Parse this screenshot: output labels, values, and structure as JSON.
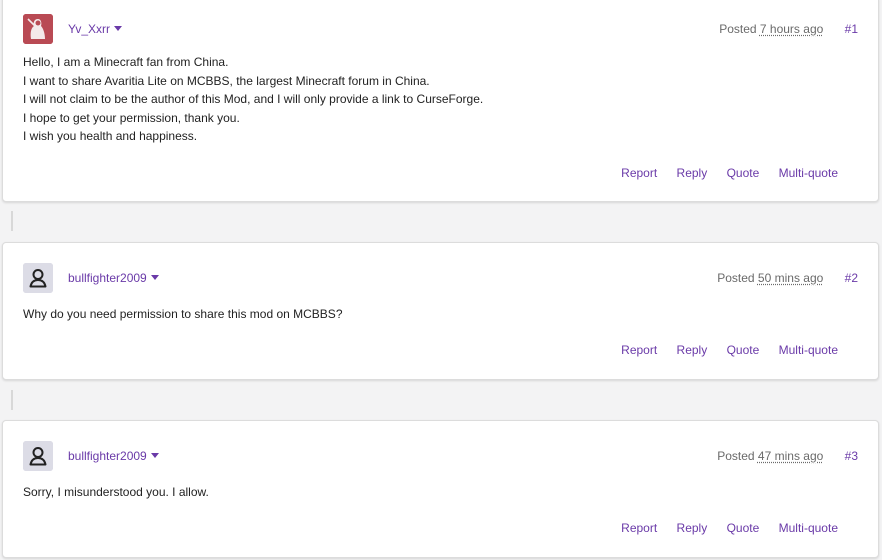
{
  "posts": [
    {
      "author": "Yv_Xxrr",
      "posted_label": "Posted",
      "time": "7 hours ago",
      "number": "#1",
      "avatar": "custom-avatar-icon",
      "body": [
        "Hello, I am a Minecraft fan from China.",
        "I want to share Avaritia Lite on MCBBS, the largest Minecraft forum in China.",
        "I will not claim to be the author of this Mod, and I will only provide a link to CurseForge.",
        "I hope to get your permission, thank you.",
        "I wish you health and happiness."
      ]
    },
    {
      "author": "bullfighter2009",
      "posted_label": "Posted",
      "time": "50 mins ago",
      "number": "#2",
      "avatar": "default-user-icon",
      "body": [
        "Why do you need permission to share this mod on MCBBS?"
      ]
    },
    {
      "author": "bullfighter2009",
      "posted_label": "Posted",
      "time": "47 mins ago",
      "number": "#3",
      "avatar": "default-user-icon",
      "body": [
        "Sorry, I misunderstood you. I allow."
      ]
    }
  ],
  "actions": {
    "report": "Report",
    "reply": "Reply",
    "quote": "Quote",
    "multi_quote": "Multi-quote"
  },
  "colors": {
    "link": "#6a3aa8",
    "background": "#f3f3f4",
    "avatar_custom": "#b94a54",
    "avatar_default": "#dcdce6"
  }
}
